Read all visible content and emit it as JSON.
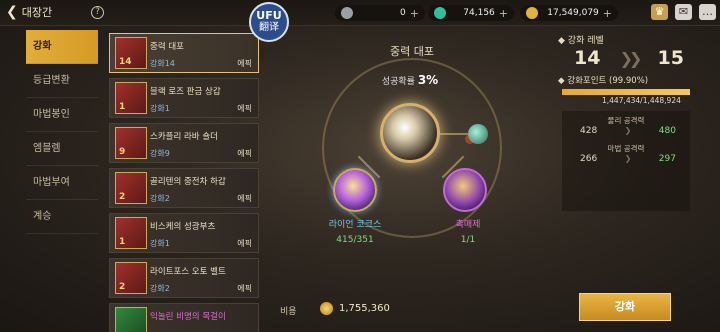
{
  "header": {
    "back_label": "대장간",
    "help_icon": "?",
    "logo_top": "UFU",
    "logo_bottom": "翻译",
    "currencies": [
      {
        "icon": "c-coin-icon",
        "value": "0",
        "color": "#9aa0a8"
      },
      {
        "icon": "crystal-icon",
        "value": "74,156",
        "color": "#2fbf9a"
      },
      {
        "icon": "gold-coin-icon",
        "value": "17,549,079",
        "color": "#e0b43a"
      }
    ]
  },
  "sidebar": {
    "items": [
      {
        "label": "강화",
        "active": true
      },
      {
        "label": "등급변환",
        "active": false
      },
      {
        "label": "마법봉인",
        "active": false
      },
      {
        "label": "엠블렘",
        "active": false
      },
      {
        "label": "마법부여",
        "active": false
      },
      {
        "label": "계승",
        "active": false
      }
    ]
  },
  "items": [
    {
      "name": "중력 대포",
      "level": "14",
      "grade": "강화14",
      "rarity": "에픽",
      "selected": true
    },
    {
      "name": "블랙 로즈 판금 상갑",
      "level": "1",
      "grade": "강화1",
      "rarity": "에픽",
      "selected": false
    },
    {
      "name": "스카플리 라바 숄더",
      "level": "9",
      "grade": "강화9",
      "rarity": "에픽",
      "selected": false
    },
    {
      "name": "골리텐의 중전차 하갑",
      "level": "2",
      "grade": "강화2",
      "rarity": "에픽",
      "selected": false
    },
    {
      "name": "비스케의 성광부츠",
      "level": "1",
      "grade": "강화1",
      "rarity": "에픽",
      "selected": false
    },
    {
      "name": "라이트포스 오토 벨트",
      "level": "2",
      "grade": "강화2",
      "rarity": "에픽",
      "selected": false
    },
    {
      "name": "익놀린 비명의 목걸이",
      "level": "",
      "grade": "",
      "rarity": "",
      "selected": false
    }
  ],
  "center": {
    "title": "중력 대포",
    "rate_label": "성공확률",
    "rate_value": "3%",
    "materials": [
      {
        "name": "라이언 코크스",
        "count": "415/351"
      },
      {
        "name": "촉매제",
        "count": "1/1"
      }
    ]
  },
  "cost": {
    "label": "비용",
    "value": "1,755,360"
  },
  "enhance_button": "강화",
  "right_panel": {
    "level_title": "강화 레벨",
    "level_from": "14",
    "level_to": "15",
    "point_title": "강화포인트 (99.90%)",
    "point_ratio": 0.999,
    "point_text": "1,447,434/1,448,924",
    "stats": [
      {
        "label": "물리 공격력",
        "from": "428",
        "to": "480"
      },
      {
        "label": "마법 공격력",
        "from": "266",
        "to": "297"
      }
    ]
  }
}
